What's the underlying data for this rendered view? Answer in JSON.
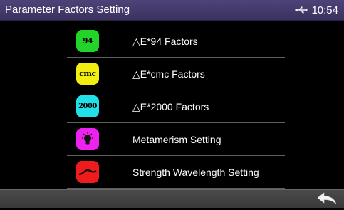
{
  "header": {
    "title": "Parameter Factors Setting",
    "time": "10:54",
    "status_icon": "usb-icon"
  },
  "menu": {
    "items": [
      {
        "label": "△E*94 Factors",
        "icon_text": "94",
        "icon_name": "de94-icon",
        "icon_color": "#22d42a"
      },
      {
        "label": "△E*cmc Factors",
        "icon_text": "cmc",
        "icon_name": "decmc-icon",
        "icon_color": "#f2ef10"
      },
      {
        "label": "△E*2000 Factors",
        "icon_text": "2000",
        "icon_name": "de2000-icon",
        "icon_color": "#22e0e8"
      },
      {
        "label": "Metamerism Setting",
        "icon_name": "lightbulb-icon",
        "icon_color": "#ee22ee"
      },
      {
        "label": "Strength Wavelength Setting",
        "icon_name": "wave-icon",
        "icon_color": "#ee1c1c"
      }
    ]
  },
  "footer": {
    "back_icon": "back-arrow-icon"
  }
}
